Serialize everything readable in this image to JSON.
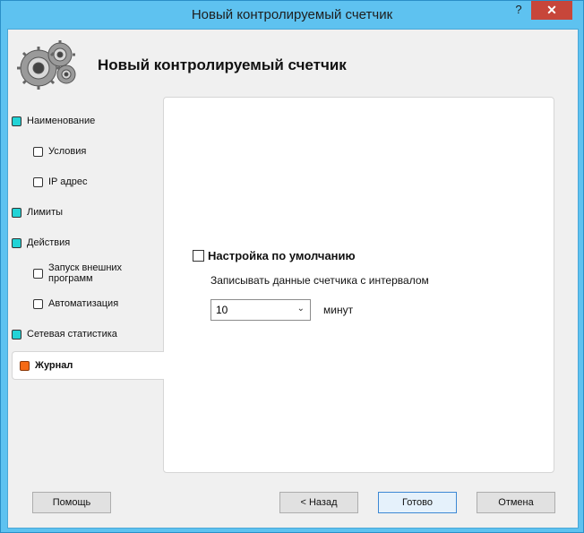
{
  "window": {
    "title": "Новый контролируемый счетчик",
    "help_label": "?",
    "close_label": "✕"
  },
  "header": {
    "title": "Новый контролируемый счетчик",
    "icon": "gears-icon"
  },
  "nav": {
    "items": [
      {
        "label": "Наименование",
        "level": 0
      },
      {
        "label": "Условия",
        "level": 1
      },
      {
        "label": "IP адрес",
        "level": 1
      },
      {
        "label": "Лимиты",
        "level": 0
      },
      {
        "label": "Действия",
        "level": 0
      },
      {
        "label": "Запуск внешних программ",
        "level": 1
      },
      {
        "label": "Автоматизация",
        "level": 1
      },
      {
        "label": "Сетевая статистика",
        "level": 0
      },
      {
        "label": "Журнал",
        "level": 0,
        "active": true
      }
    ]
  },
  "content": {
    "default_checkbox_label": "Настройка по умолчанию",
    "default_checked": false,
    "interval_label": "Записывать данные счетчика с интервалом",
    "interval_value": "10",
    "minutes_label": "минут"
  },
  "buttons": {
    "help": "Помощь",
    "back": "< Назад",
    "done": "Готово",
    "cancel": "Отмена"
  },
  "colors": {
    "titlebar": "#5ec2f0",
    "close": "#c7463a",
    "nav_box": "#22d3d6",
    "nav_active_box": "#f56a14"
  }
}
